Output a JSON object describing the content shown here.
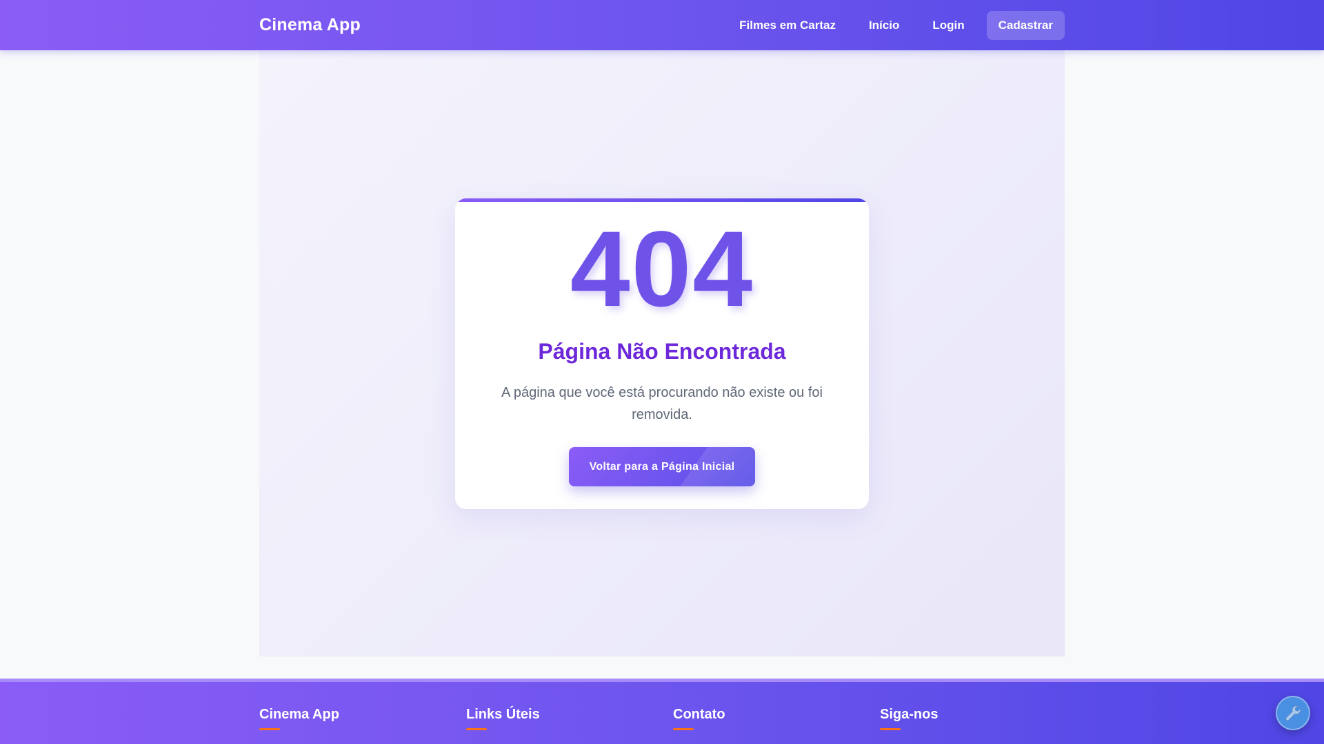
{
  "navbar": {
    "brand": "Cinema App",
    "links": [
      {
        "label": "Filmes em Cartaz"
      },
      {
        "label": "Início"
      },
      {
        "label": "Login"
      },
      {
        "label": "Cadastrar"
      }
    ]
  },
  "error": {
    "code": "404",
    "title": "Página Não Encontrada",
    "message": "A página que você está procurando não existe ou foi removida.",
    "button_label": "Voltar para a Página Inicial"
  },
  "footer": {
    "columns": [
      {
        "heading": "Cinema App"
      },
      {
        "heading": "Links Úteis"
      },
      {
        "heading": "Contato"
      },
      {
        "heading": "Siga-nos"
      }
    ]
  },
  "colors": {
    "primary_start": "#8b5cf6",
    "primary_end": "#4f46e5",
    "title": "#6d28d9",
    "accent_underline": "#f97316",
    "fab": "#4a90e2"
  },
  "icons": {
    "fab": "wrench-icon"
  }
}
